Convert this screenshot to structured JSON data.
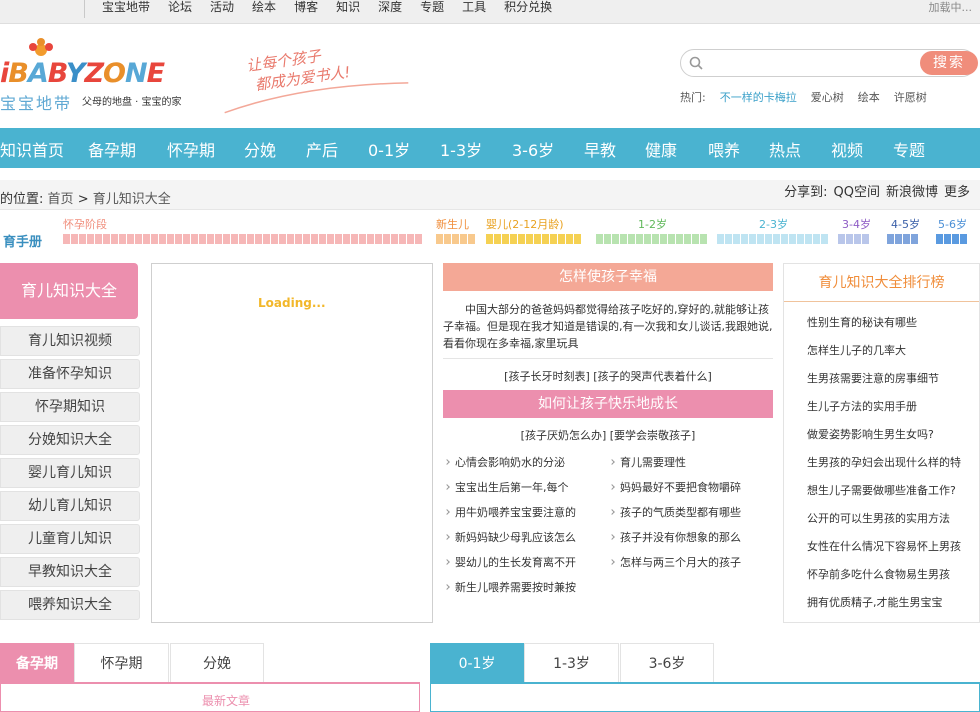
{
  "topbar": {
    "links": [
      "宝宝地带",
      "论坛",
      "活动",
      "绘本",
      "博客",
      "知识",
      "深度",
      "专题",
      "工具",
      "积分兑换"
    ],
    "loading": "加载中..."
  },
  "logo": {
    "wordmark": "iBABYZONE",
    "cn_name": "宝宝地带",
    "tagline": "父母的地盘 · 宝宝的家"
  },
  "slogan": {
    "line1": "让每个孩子",
    "line2": "都成为爱书人!"
  },
  "search": {
    "placeholder": "",
    "button": "搜索",
    "hot_label": "热门:",
    "hot_words": [
      "不一样的卡梅拉",
      "爱心树",
      "绘本",
      "许愿树"
    ]
  },
  "mainnav": [
    "知识首页",
    "备孕期",
    "怀孕期",
    "分娩",
    "产后",
    "0-1岁",
    "1-3岁",
    "3-6岁",
    "早教",
    "健康",
    "喂养",
    "热点",
    "视频",
    "专题"
  ],
  "breadcrumb": {
    "label": "的位置:",
    "home": "首页",
    "sep": ">",
    "current": "育儿知识大全"
  },
  "share": {
    "label": "分享到:",
    "targets": [
      "QQ空间",
      "新浪微博",
      "更多"
    ]
  },
  "handbook": {
    "title": "育手册",
    "stages": [
      {
        "label": "怀孕阶段",
        "color": "#f08d7b",
        "fill": "#f6b7b7"
      },
      {
        "label": "新生儿",
        "color": "#f08d3a",
        "fill": "#f8c98d"
      },
      {
        "label": "婴儿(2-12月龄)",
        "color": "#e9a221",
        "fill": "#f5d153"
      },
      {
        "label": "1-2岁",
        "color": "#5fb85a",
        "fill": "#b8e3b0"
      },
      {
        "label": "2-3岁",
        "color": "#4ab3d0",
        "fill": "#bfe4f2"
      },
      {
        "label": "3-4岁",
        "color": "#8e5cc5",
        "fill": "#b9c6ea"
      },
      {
        "label": "4-5岁",
        "color": "#3a5fa8",
        "fill": "#7fa4dc"
      },
      {
        "label": "5-6岁",
        "color": "#4a8fd6",
        "fill": "#5a9ae0"
      }
    ]
  },
  "sidebar": {
    "title": "育儿知识大全",
    "items": [
      "育儿知识视频",
      "准备怀孕知识",
      "怀孕期知识",
      "分娩知识大全",
      "婴儿育儿知识",
      "幼儿育儿知识",
      "儿童育儿知识",
      "早教知识大全",
      "喂养知识大全"
    ]
  },
  "loading_panel": {
    "text": "Loading..."
  },
  "middle": {
    "box1_title": "怎样使孩子幸福",
    "box1_text": "中国大部分的爸爸妈妈都觉得给孩子吃好的,穿好的,就能够让孩子幸福。但是现在我才知道是错误的,有一次我和女儿谈话,我跟她说,看看你现在多幸福,家里玩具",
    "box1_links": [
      "[孩子长牙时刻表]",
      "[孩子的哭声代表着什么]"
    ],
    "box2_title": "如何让孩子快乐地成长",
    "box2_links": [
      "[孩子厌奶怎么办]",
      "[要学会崇敬孩子]"
    ],
    "list": [
      "心情会影响奶水的分泌",
      "育儿需要理性",
      "宝宝出生后第一年,每个",
      "妈妈最好不要把食物嚼碎",
      "用牛奶喂养宝宝要注意的",
      "孩子的气质类型都有哪些",
      "新妈妈缺少母乳应该怎么",
      "孩子并没有你想象的那么",
      "婴幼儿的生长发育离不开",
      "怎样与两三个月大的孩子",
      "新生儿喂养需要按时兼按"
    ]
  },
  "ranking": {
    "title": "育儿知识大全排行榜",
    "items": [
      "性别生育的秘诀有哪些",
      "怎样生儿子的几率大",
      "生男孩需要注意的房事细节",
      "生儿子方法的实用手册",
      "做爱姿势影响生男生女吗?",
      "生男孩的孕妇会出现什么样的特",
      "想生儿子需要做哪些准备工作?",
      "公开的可以生男孩的实用方法",
      "女性在什么情况下容易怀上男孩",
      "怀孕前多吃什么食物易生男孩",
      "拥有优质精子,才能生男宝宝"
    ]
  },
  "bottom": {
    "left_tabs": [
      "备孕期",
      "怀孕期",
      "分娩"
    ],
    "right_tabs": [
      "0-1岁",
      "1-3岁",
      "3-6岁"
    ],
    "latest": "最新文章"
  }
}
